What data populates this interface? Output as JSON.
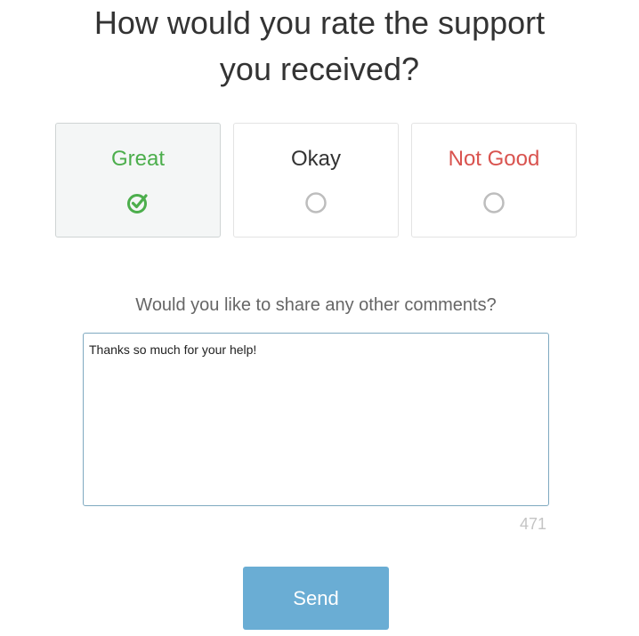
{
  "header": {
    "title_line1": "How would you rate the support",
    "title_line2": "you received?"
  },
  "rating": {
    "options": [
      {
        "label": "Great",
        "color": "#4cae4c",
        "selected": true,
        "icon": "check-circle-icon"
      },
      {
        "label": "Okay",
        "color": "#333333",
        "selected": false,
        "icon": "radio-empty-icon"
      },
      {
        "label": "Not Good",
        "color": "#d9534f",
        "selected": false,
        "icon": "radio-empty-icon"
      }
    ]
  },
  "comments": {
    "label": "Would you like to share any other comments?",
    "value": "Thanks so much for your help!",
    "remaining_chars": "471",
    "border_color": "#7fa9c0"
  },
  "actions": {
    "send_label": "Send",
    "send_color": "#6aadd4"
  }
}
